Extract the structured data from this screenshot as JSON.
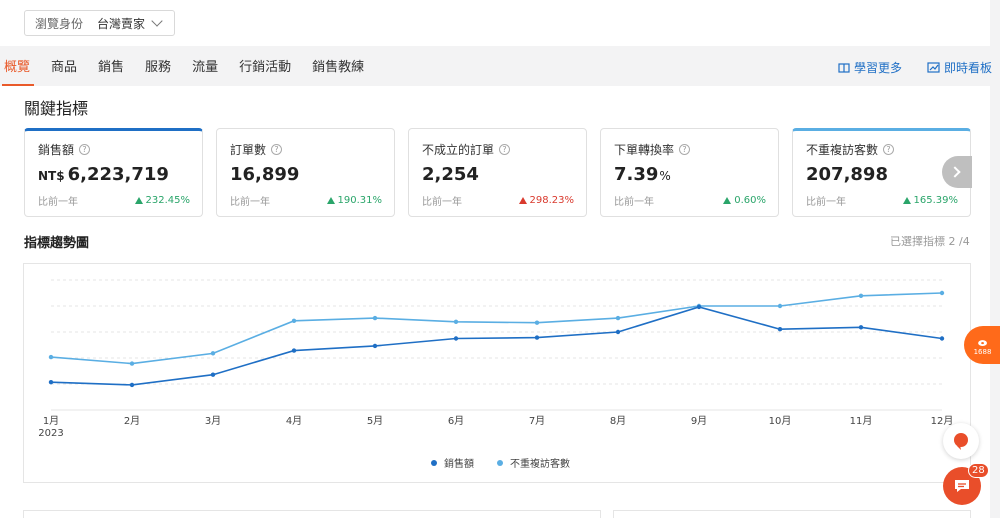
{
  "identity": {
    "label": "瀏覽身份",
    "value": "台灣賣家"
  },
  "tabs": [
    "概覽",
    "商品",
    "銷售",
    "服務",
    "流量",
    "行銷活動",
    "銷售教練"
  ],
  "links": {
    "learn_more": "學習更多",
    "live_board": "即時看板"
  },
  "section_title": "關鍵指標",
  "cards": [
    {
      "name": "銷售額",
      "prefix": "NT$",
      "value": "6,223,719",
      "suffix": "",
      "compare": "比前一年",
      "change": "232.45%",
      "direction": "up"
    },
    {
      "name": "訂單數",
      "prefix": "",
      "value": "16,899",
      "suffix": "",
      "compare": "比前一年",
      "change": "190.31%",
      "direction": "up"
    },
    {
      "name": "不成立的訂單",
      "prefix": "",
      "value": "2,254",
      "suffix": "",
      "compare": "比前一年",
      "change": "298.23%",
      "direction": "up-red"
    },
    {
      "name": "下單轉換率",
      "prefix": "",
      "value": "7.39",
      "suffix": "%",
      "compare": "比前一年",
      "change": "0.60%",
      "direction": "up"
    },
    {
      "name": "不重複訪客數",
      "prefix": "",
      "value": "207,898",
      "suffix": "",
      "compare": "比前一年",
      "change": "165.39%",
      "direction": "up"
    }
  ],
  "trend": {
    "title": "指標趨勢圖",
    "selected": "已選擇指標 2 /4"
  },
  "chart_data": {
    "type": "line",
    "x": [
      "1月",
      "2月",
      "3月",
      "4月",
      "5月",
      "6月",
      "7月",
      "8月",
      "9月",
      "10月",
      "11月",
      "12月"
    ],
    "x_sub": "2023",
    "series": [
      {
        "name": "銷售額",
        "color": "#1f6fc5",
        "values": [
          30,
          27,
          38,
          64,
          69,
          77,
          78,
          84,
          111,
          87,
          89,
          77
        ]
      },
      {
        "name": "不重複訪客數",
        "color": "#5aaee3",
        "values": [
          57,
          50,
          61,
          96,
          99,
          95,
          94,
          99,
          112,
          112,
          123,
          126
        ]
      }
    ],
    "ylim": [
      0,
      140
    ],
    "grid": true,
    "legend": "bottom"
  },
  "colors": {
    "accent": "#e95a2a",
    "link": "#1f6fc5",
    "up": "#2aa56a",
    "down": "#d93a2e"
  },
  "floating": {
    "brand": "1688",
    "chat_badge": "28"
  }
}
